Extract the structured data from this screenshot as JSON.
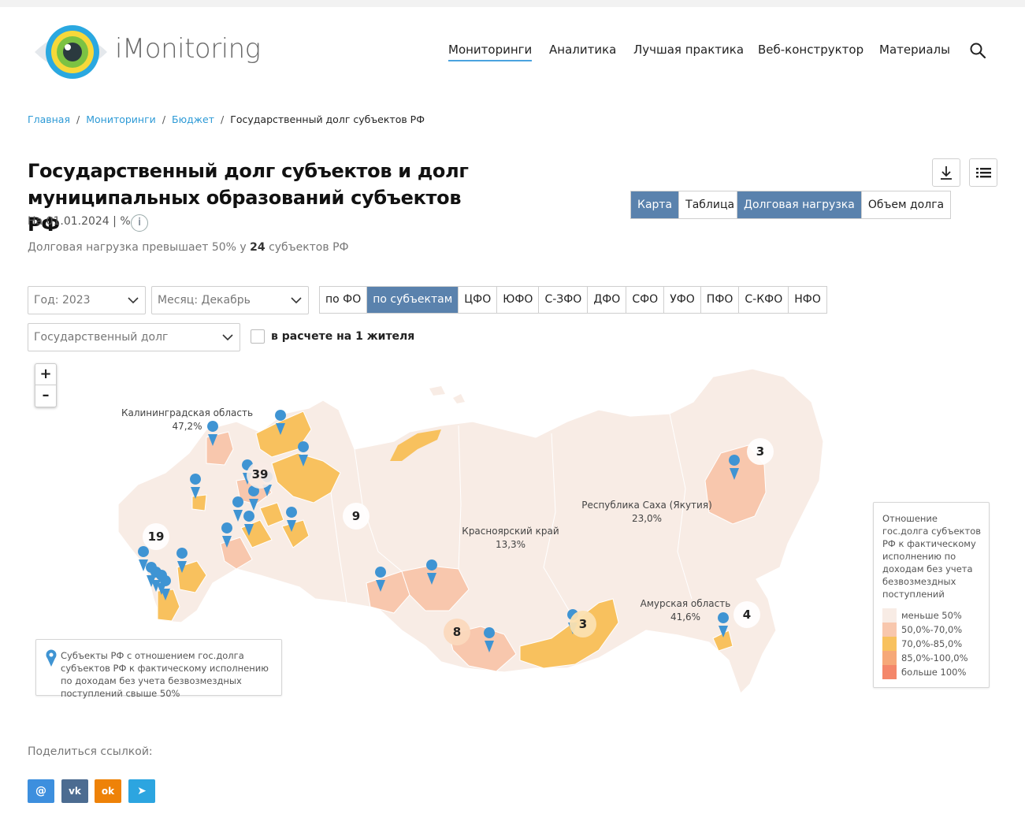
{
  "header": {
    "brand": "iMonitoring",
    "nav": [
      {
        "label": "Мониторинги",
        "active": true
      },
      {
        "label": "Аналитика"
      },
      {
        "label": "Лучшая практика"
      },
      {
        "label": "Веб-конструктор"
      },
      {
        "label": "Материалы"
      }
    ]
  },
  "breadcrumb": {
    "items": [
      "Главная",
      "Мониторинги",
      "Бюджет"
    ],
    "sep": "/",
    "current": "Государственный долг субъектов РФ"
  },
  "title": {
    "line1": "Государственный долг субъектов и долг",
    "line2": "муниципальных образований субъектов РФ",
    "date": "На 01.01.2024 | %",
    "info": "i",
    "subtitle_pre": "Долговая нагрузка превышает 50% у",
    "subtitle_count": "24",
    "subtitle_post": "субъектов РФ"
  },
  "view_toggle": [
    "Карта",
    "Таблица"
  ],
  "measure_toggle": [
    "Долговая нагрузка",
    "Объем долга"
  ],
  "filters": {
    "year": "Год: 2023",
    "month": "Месяц: Декабрь",
    "indicator": "Государственный долг",
    "per_capita": "в расчете на 1 жителя",
    "districts": [
      "по ФО",
      "по субъектам",
      "ЦФО",
      "ЮФО",
      "С-ЗФО",
      "ДФО",
      "СФО",
      "УФО",
      "ПФО",
      "С-КФО",
      "НФО"
    ]
  },
  "map": {
    "labels": [
      {
        "name": "Калининградская область",
        "value": "47,2%"
      },
      {
        "name": "Красноярский край",
        "value": "13,3%"
      },
      {
        "name": "Республика Саха (Якутия)",
        "value": "23,0%"
      },
      {
        "name": "Амурская область",
        "value": "41,6%"
      }
    ],
    "clusters": [
      "39",
      "19",
      "9",
      "8",
      "3",
      "3",
      "4"
    ],
    "zoom_in": "+",
    "zoom_out": "–"
  },
  "pin_legend": {
    "text": "Субъекты РФ с отношением гос.долга субъектов РФ к фактическому исполнению по доходам без учета безвозмездных поступлений свыше 50%"
  },
  "legend": {
    "title": "Отношение гос.долга субъектов РФ к фактическому исполнению по доходам без учета безвозмездных поступлений",
    "items": [
      {
        "label": "меньше 50%",
        "color": "#f8ece5"
      },
      {
        "label": "50,0%-70,0%",
        "color": "#f8c7ad"
      },
      {
        "label": "70,0%-85,0%",
        "color": "#f8c15e"
      },
      {
        "label": "85,0%-100,0%",
        "color": "#f6a878"
      },
      {
        "label": "больше 100%",
        "color": "#f4876a"
      }
    ]
  },
  "share": {
    "label": "Поделиться ссылкой:",
    "buttons": [
      {
        "glyph": "@",
        "color": "#3d8fde"
      },
      {
        "glyph": "vk",
        "color": "#4c6c91"
      },
      {
        "glyph": "ok",
        "color": "#ee8208"
      },
      {
        "glyph": "➤",
        "color": "#2ca5e0"
      }
    ]
  },
  "colors": {
    "accent": "#4aa3df",
    "segment_active": "#5a82ad",
    "pin": "#3f94d3"
  }
}
